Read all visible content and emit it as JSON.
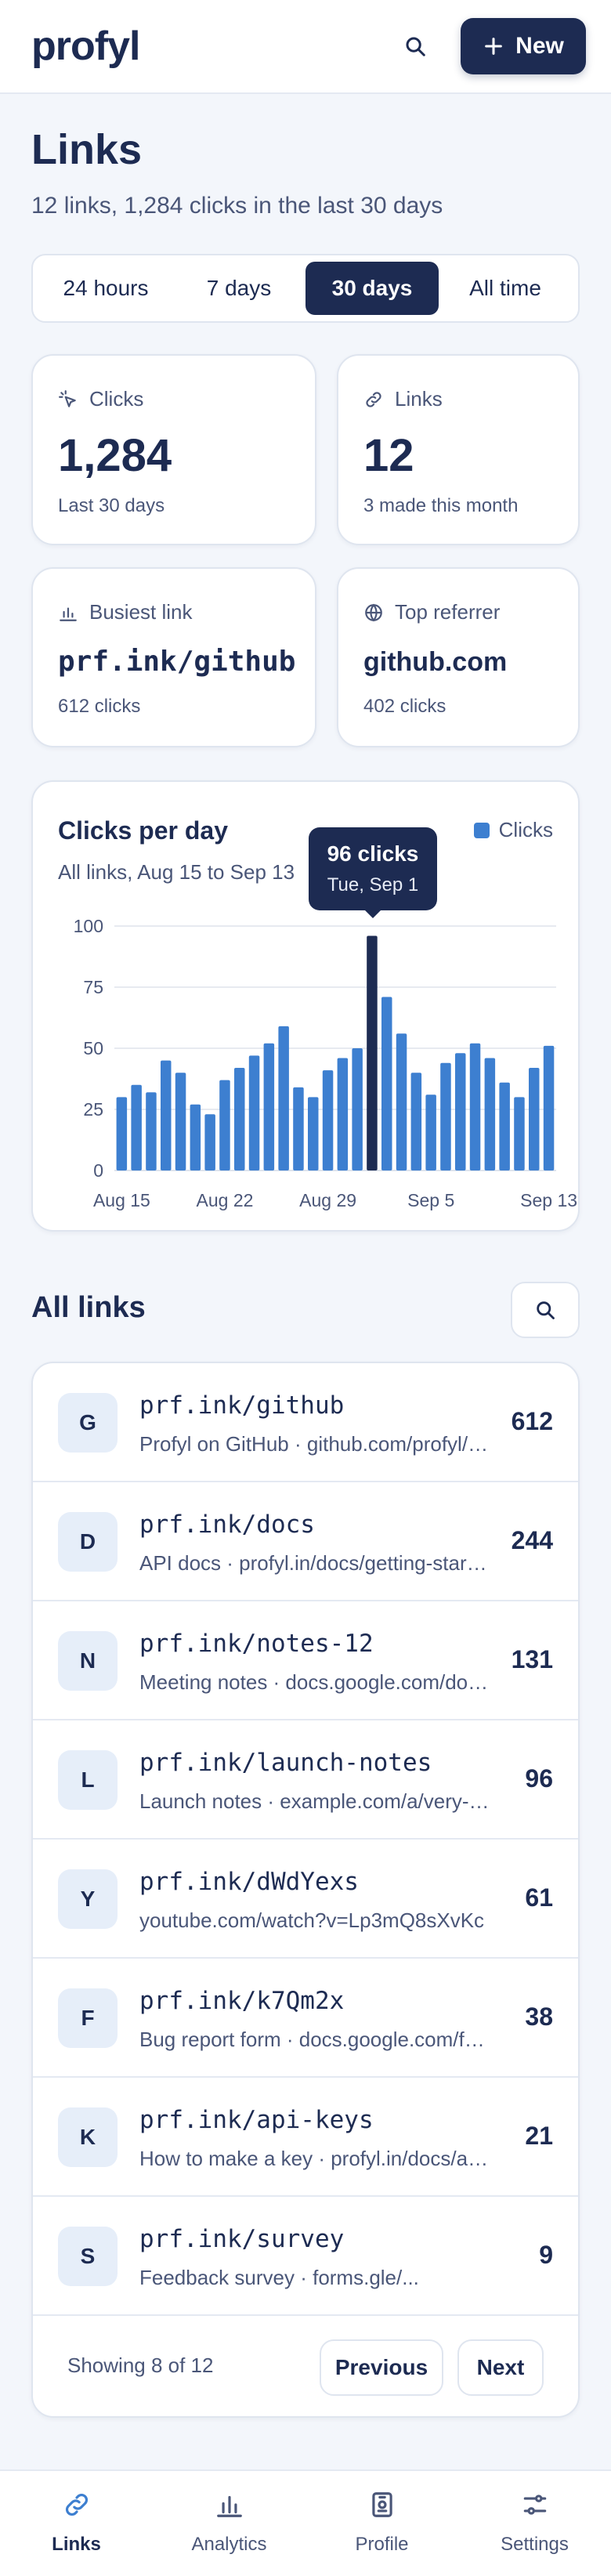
{
  "header": {
    "logo": "profyl",
    "new_label": "New"
  },
  "page": {
    "title": "Links",
    "subtitle": "12 links, 1,284 clicks in the last 30 days"
  },
  "range_tabs": [
    {
      "label": "24 hours",
      "active": false
    },
    {
      "label": "7 days",
      "active": false
    },
    {
      "label": "30 days",
      "active": true
    },
    {
      "label": "All time",
      "active": false
    }
  ],
  "stats": {
    "clicks": {
      "label": "Clicks",
      "value": "1,284",
      "sub": "Last 30 days"
    },
    "links": {
      "label": "Links",
      "value": "12",
      "sub": "3 made this month"
    },
    "busiest": {
      "label": "Busiest link",
      "value": "prf.ink/github",
      "sub": "612 clicks"
    },
    "referrer": {
      "label": "Top referrer",
      "value": "github.com",
      "sub": "402 clicks"
    }
  },
  "chart_data": {
    "type": "bar",
    "title": "Clicks per day",
    "subtitle": "All links, Aug 15 to Sep 13",
    "legend": "Clicks",
    "x_tick_labels": [
      "Aug 15",
      "Aug 22",
      "Aug 29",
      "Sep 5",
      "Sep 13"
    ],
    "y_ticks": [
      0,
      25,
      50,
      75,
      100
    ],
    "ylim": [
      0,
      100
    ],
    "x": [
      "Aug 15",
      "Aug 16",
      "Aug 17",
      "Aug 18",
      "Aug 19",
      "Aug 20",
      "Aug 21",
      "Aug 22",
      "Aug 23",
      "Aug 24",
      "Aug 25",
      "Aug 26",
      "Aug 27",
      "Aug 28",
      "Aug 29",
      "Aug 30",
      "Aug 31",
      "Sep 1",
      "Sep 2",
      "Sep 3",
      "Sep 4",
      "Sep 5",
      "Sep 6",
      "Sep 7",
      "Sep 8",
      "Sep 9",
      "Sep 10",
      "Sep 11",
      "Sep 12",
      "Sep 13"
    ],
    "values": [
      30,
      35,
      32,
      45,
      40,
      27,
      23,
      37,
      42,
      47,
      52,
      59,
      34,
      30,
      41,
      46,
      50,
      96,
      71,
      56,
      40,
      31,
      44,
      48,
      52,
      46,
      36,
      30,
      42,
      51
    ],
    "highlight_index": 17,
    "tooltip": {
      "value": "96 clicks",
      "date": "Tue, Sep 1"
    },
    "colors": {
      "bar": "#3d7fd0",
      "highlight": "#1d2b52",
      "grid": "#dfe4ec"
    }
  },
  "all_links": {
    "title": "All links",
    "rows": [
      {
        "initial": "G",
        "short": "prf.ink/github",
        "desc": "Profyl on GitHub · github.com/profyl/profyl",
        "count": "612"
      },
      {
        "initial": "D",
        "short": "prf.ink/docs",
        "desc": "API docs · profyl.in/docs/getting-started",
        "count": "244"
      },
      {
        "initial": "N",
        "short": "prf.ink/notes-12",
        "desc": "Meeting notes · docs.google.com/document",
        "count": "131"
      },
      {
        "initial": "L",
        "short": "prf.ink/launch-notes",
        "desc": "Launch notes · example.com/a/very-long-path",
        "count": "96"
      },
      {
        "initial": "Y",
        "short": "prf.ink/dWdYexs",
        "desc": "youtube.com/watch?v=Lp3mQ8sXvKc",
        "count": "61"
      },
      {
        "initial": "F",
        "short": "prf.ink/k7Qm2x",
        "desc": "Bug report form · docs.google.com/forms",
        "count": "38"
      },
      {
        "initial": "K",
        "short": "prf.ink/api-keys",
        "desc": "How to make a key · profyl.in/docs/api-keys",
        "count": "21"
      },
      {
        "initial": "S",
        "short": "prf.ink/survey",
        "desc": "Feedback survey · forms.gle/...",
        "count": "9"
      }
    ],
    "pager": {
      "text": "Showing 8 of 12",
      "prev": "Previous",
      "next": "Next"
    }
  },
  "bottom_nav": [
    {
      "label": "Links",
      "icon": "link-icon",
      "active": true
    },
    {
      "label": "Analytics",
      "icon": "bar-chart-icon",
      "active": false
    },
    {
      "label": "Profile",
      "icon": "badge-icon",
      "active": false
    },
    {
      "label": "Settings",
      "icon": "sliders-icon",
      "active": false
    }
  ]
}
